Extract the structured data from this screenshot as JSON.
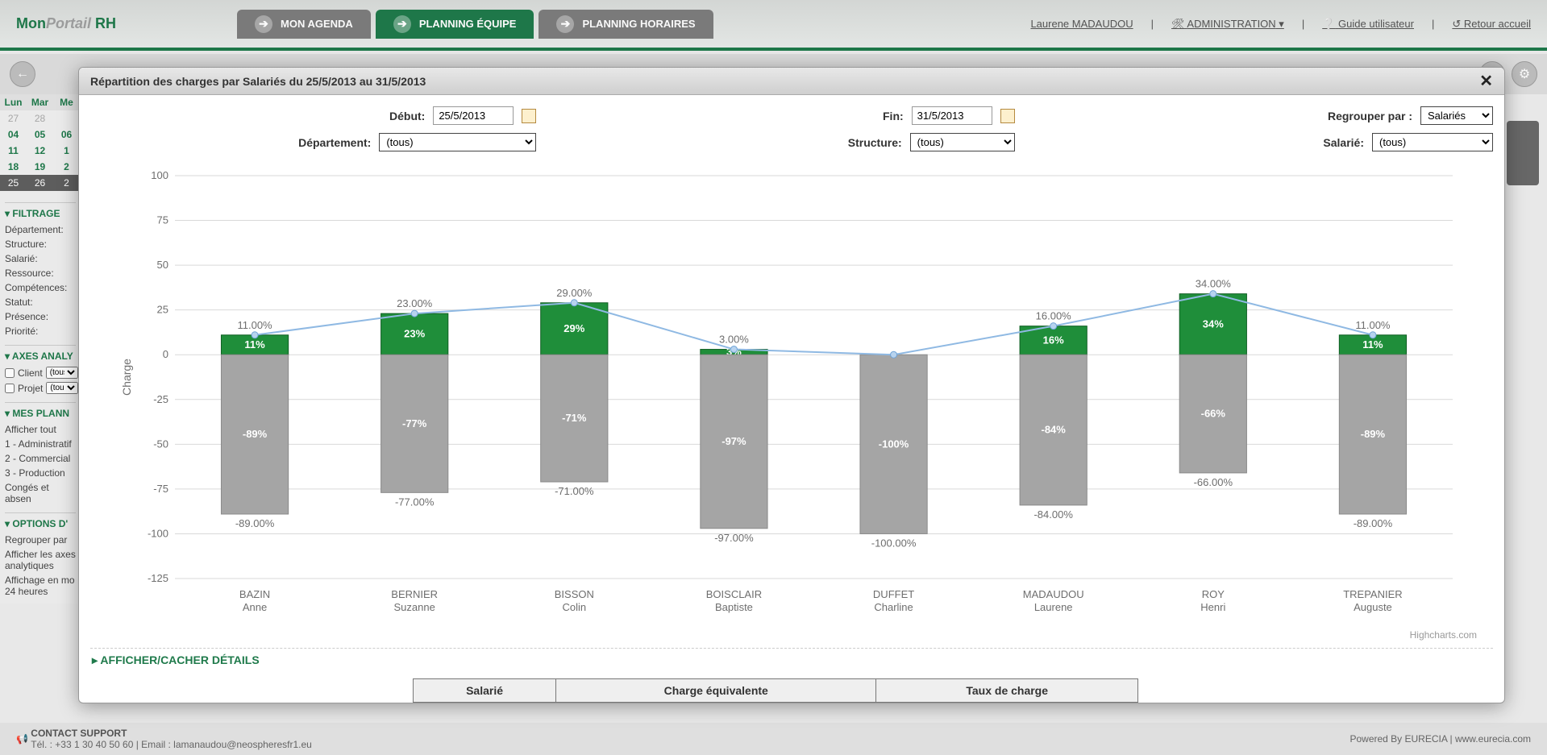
{
  "app": {
    "logo_mon": "Mon",
    "logo_portail": "Portail",
    "logo_rh": "RH",
    "tabs": [
      {
        "label": "MON AGENDA"
      },
      {
        "label": "PLANNING ÉQUIPE"
      },
      {
        "label": "PLANNING HORAIRES"
      }
    ],
    "user": "Laurene MADAUDOU",
    "admin_label": "ADMINISTRATION",
    "guide_label": "Guide utilisateur",
    "return_label": "Retour accueil"
  },
  "footer": {
    "contact_title": "CONTACT SUPPORT",
    "contact_line": "Tél. : +33 1 30 40 50 60  |  Email : lamanaudou@neospheresfr1.eu",
    "powered": "Powered By EURECIA  |  www.eurecia.com"
  },
  "sidebar": {
    "filtrage": "FILTRAGE",
    "items_filtrage": [
      "Département:",
      "Structure:",
      "Salarié:",
      "Ressource:",
      "Compétences:",
      "Statut:",
      "Présence:",
      "Priorité:"
    ],
    "axes": "AXES ANALY",
    "client": "Client",
    "projet": "Projet",
    "tous": "(tous)",
    "mes_plann": "MES PLANN",
    "plan_items": [
      "Afficher tout",
      "1 - Administratif",
      "2 - Commercial",
      "3 - Production",
      "Congés et absen"
    ],
    "options": "OPTIONS D'",
    "opt_items": [
      "Regrouper par",
      "Afficher les axes analytiques",
      "Affichage en mo 24 heures"
    ]
  },
  "calendar": {
    "hdr": [
      "Lun",
      "Mar",
      "Me"
    ],
    "rows": [
      [
        "27",
        "28",
        ""
      ],
      [
        "04",
        "05",
        "06"
      ],
      [
        "11",
        "12",
        "1"
      ],
      [
        "18",
        "19",
        "2"
      ],
      [
        "25",
        "26",
        "2"
      ]
    ]
  },
  "modal": {
    "title": "Répartition des charges par Salariés du 25/5/2013 au 31/5/2013",
    "labels": {
      "debut": "Début:",
      "fin": "Fin:",
      "regrouper": "Regrouper par :",
      "departement": "Département:",
      "structure": "Structure:",
      "salarie": "Salarié:"
    },
    "values": {
      "debut": "25/5/2013",
      "fin": "31/5/2013",
      "regrouper": "Salariés",
      "departement": "(tous)",
      "structure": "(tous)",
      "salarie": "(tous)"
    },
    "toggle": "AFFICHER/CACHER DÉTAILS",
    "table_headers": [
      "Salarié",
      "Charge équivalente",
      "Taux de charge"
    ],
    "credit": "Highcharts.com"
  },
  "chart_data": {
    "type": "bar+line",
    "ylabel": "Charge",
    "ylim": [
      -125,
      100
    ],
    "yticks": [
      -125,
      -100,
      -75,
      -50,
      -25,
      0,
      25,
      50,
      75,
      100
    ],
    "categories": [
      "BAZIN Anne",
      "BERNIER Suzanne",
      "BISSON Colin",
      "BOISCLAIR Baptiste",
      "DUFFET Charline",
      "MADAUDOU Laurene",
      "ROY Henri",
      "TREPANIER Auguste"
    ],
    "series": [
      {
        "name": "Positive",
        "color": "#1f8e3a",
        "values": [
          11,
          23,
          29,
          3,
          0,
          16,
          34,
          11
        ]
      },
      {
        "name": "Negative",
        "color": "#a5a5a5",
        "values": [
          -89,
          -77,
          -71,
          -97,
          -100,
          -84,
          -66,
          -89
        ]
      }
    ],
    "line": {
      "color": "#8fb9e3",
      "values": [
        11,
        23,
        29,
        3,
        0,
        16,
        34,
        11
      ]
    },
    "pos_labels": [
      "11.00%",
      "23.00%",
      "29.00%",
      "3.00%",
      "",
      "16.00%",
      "34.00%",
      "11.00%"
    ],
    "neg_labels": [
      "-89.00%",
      "-77.00%",
      "-71.00%",
      "-97.00%",
      "-100.00%",
      "-84.00%",
      "-66.00%",
      "-89.00%"
    ],
    "pos_bar_labels": [
      "11%",
      "23%",
      "29%",
      "3%",
      "",
      "16%",
      "34%",
      "11%"
    ],
    "neg_bar_labels": [
      "-89%",
      "-77%",
      "-71%",
      "-97%",
      "-100%",
      "-84%",
      "-66%",
      "-89%"
    ]
  }
}
